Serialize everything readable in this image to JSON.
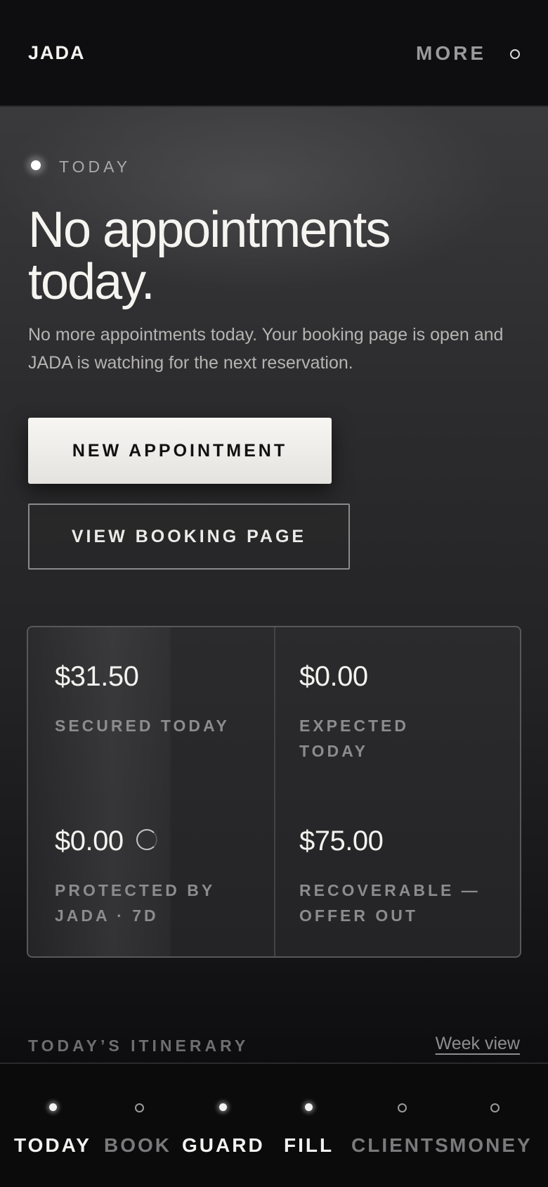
{
  "header": {
    "brand": "JADA",
    "more_label": "MORE"
  },
  "hero": {
    "eyebrow": "TODAY",
    "headline": "No appointments today.",
    "subtext": "No more appointments today. Your booking page is open and JADA is watching for the next reservation.",
    "primary_button": "NEW APPOINTMENT",
    "secondary_button": "VIEW BOOKING PAGE"
  },
  "stats": [
    {
      "value": "$31.50",
      "label": "SECURED TODAY"
    },
    {
      "value": "$0.00",
      "label": "EXPECTED TODAY"
    },
    {
      "value": "$0.00",
      "label": "PROTECTED BY JADA · 7D"
    },
    {
      "value": "$75.00",
      "label": "RECOVERABLE — OFFER OUT"
    }
  ],
  "itinerary": {
    "title": "TODAY’S ITINERARY",
    "link": "Week view"
  },
  "nav": {
    "items": [
      {
        "label": "TODAY",
        "active": true
      },
      {
        "label": "BOOK",
        "active": false
      },
      {
        "label": "GUARD",
        "active": true
      },
      {
        "label": "FILL",
        "active": true
      },
      {
        "label": "CLIENTS",
        "active": false
      },
      {
        "label": "MONEY",
        "active": false
      }
    ]
  }
}
